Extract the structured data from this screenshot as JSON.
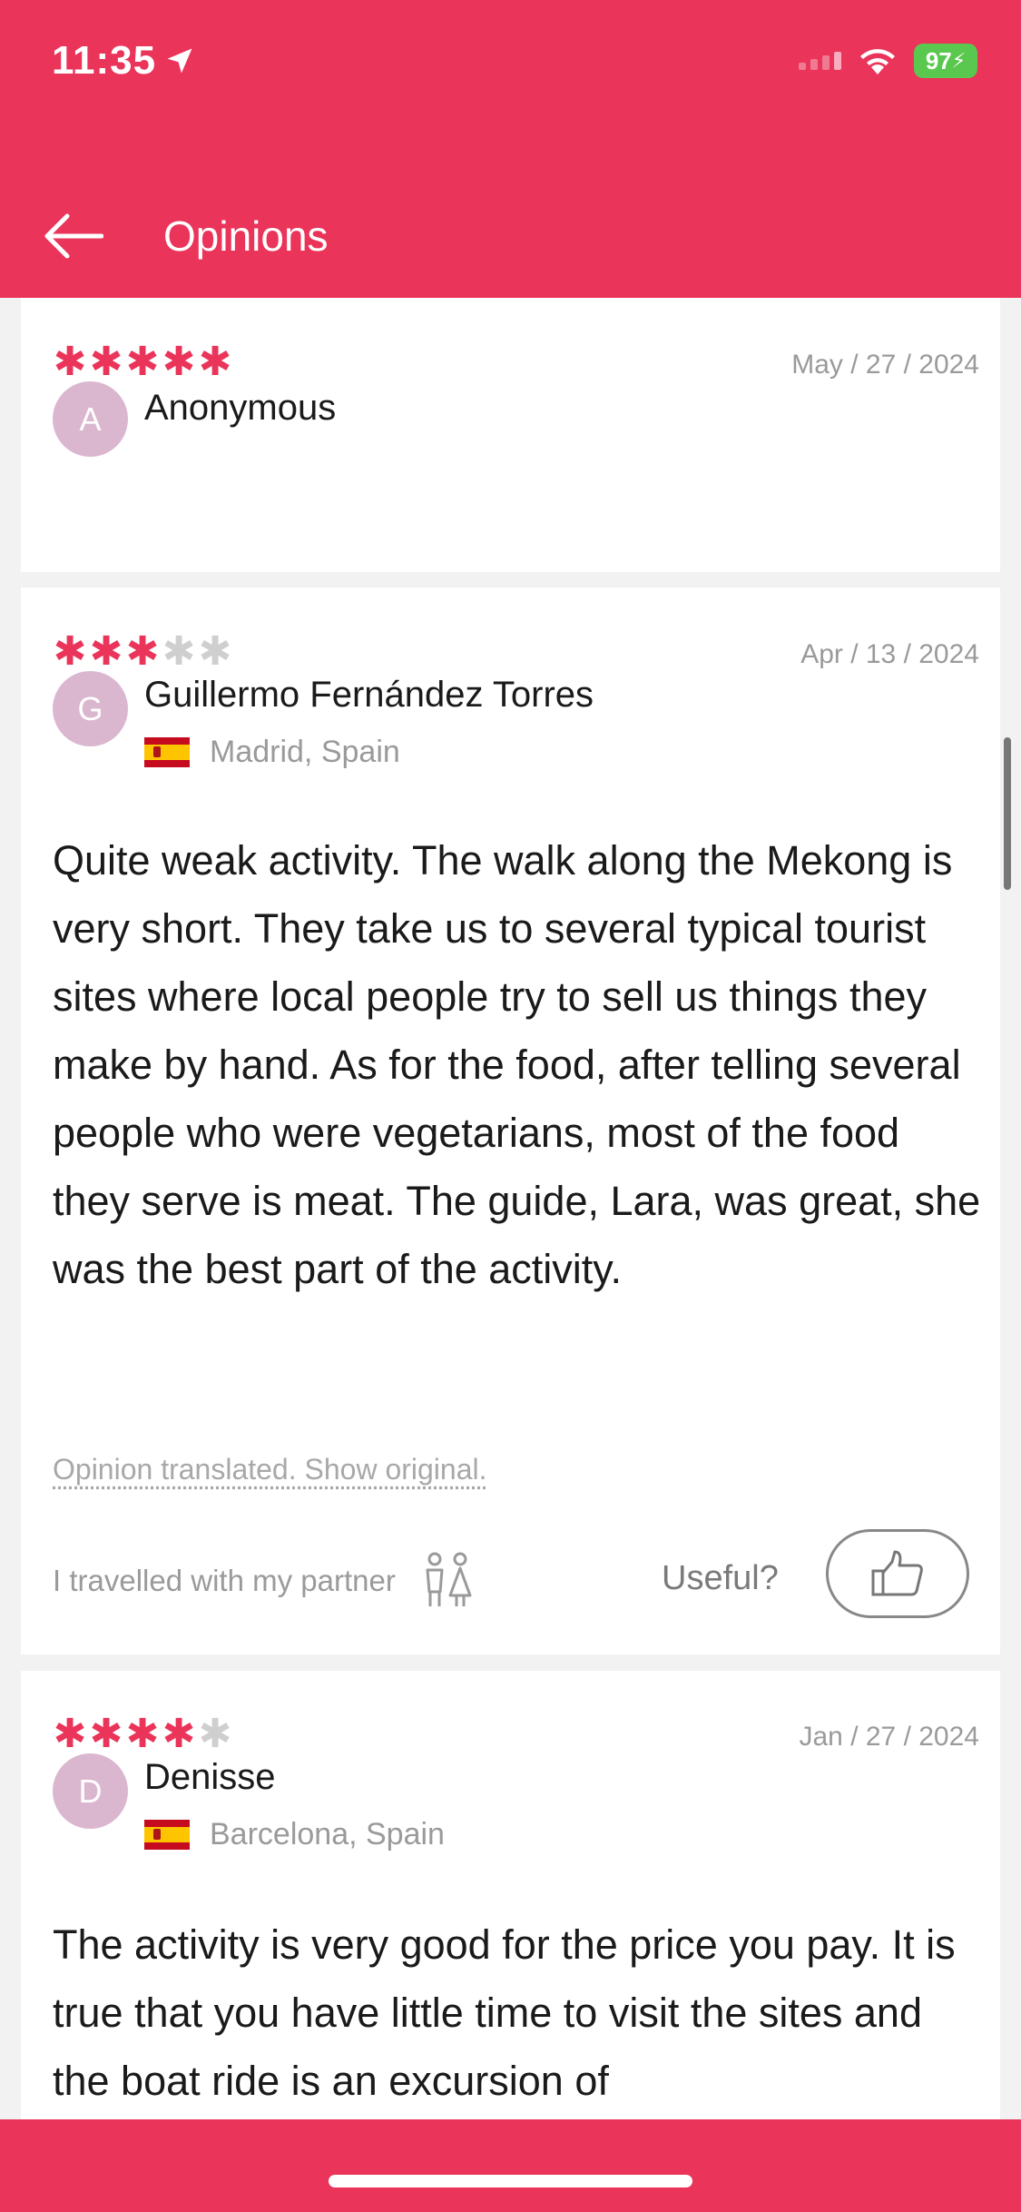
{
  "status_bar": {
    "time": "11:35",
    "battery": "97"
  },
  "header": {
    "title": "Opinions"
  },
  "reviews": [
    {
      "stars_filled": 5,
      "date": "May / 27 / 2024",
      "initial": "A",
      "name": "Anonymous"
    },
    {
      "stars_filled": 3,
      "date": "Apr / 13 / 2024",
      "initial": "G",
      "name": "Guillermo Fernández Torres",
      "location": "Madrid, Spain",
      "text": "Quite weak activity. The walk along the Mekong is very short. They take us to several typical tourist sites where local people try to sell us things they make by hand. As for the food, after telling several people who were vegetarians, most of the food they serve is meat. The guide, Lara, was great, she was the best part of the activity.",
      "translated_note": "Opinion translated. Show original.",
      "travelled_with": "I travelled with my partner",
      "useful_label": "Useful?"
    },
    {
      "stars_filled": 4,
      "date": "Jan / 27 / 2024",
      "initial": "D",
      "name": "Denisse",
      "location": "Barcelona, Spain",
      "text": "The activity is very good for the price you pay. It is true that you have little time to visit the sites and the boat ride is an excursion of"
    }
  ],
  "colors": {
    "brand": "#ea345a",
    "avatar": "#dbb7cf",
    "star_off": "#cfcfcf"
  }
}
